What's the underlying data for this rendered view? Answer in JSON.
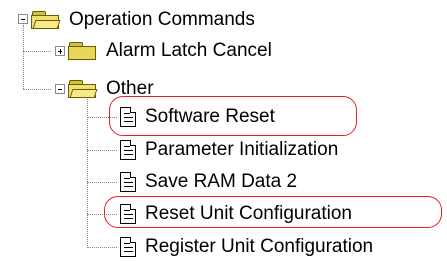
{
  "tree": {
    "root": {
      "label": "Operation Commands",
      "expanded": true,
      "icon": "open-folder-icon"
    },
    "folders": [
      {
        "label": "Alarm Latch Cancel",
        "expanded": false,
        "icon": "folder-icon"
      },
      {
        "label": "Other",
        "expanded": true,
        "icon": "open-folder-icon"
      }
    ],
    "commands": [
      {
        "label": "Software Reset",
        "icon": "document-icon",
        "highlighted": true
      },
      {
        "label": "Parameter Initialization",
        "icon": "document-icon",
        "highlighted": false
      },
      {
        "label": "Save RAM Data 2",
        "icon": "document-icon",
        "highlighted": false
      },
      {
        "label": "Reset Unit Configuration",
        "icon": "document-icon",
        "highlighted": true
      },
      {
        "label": "Register Unit Configuration",
        "icon": "document-icon",
        "highlighted": false
      }
    ]
  },
  "colors": {
    "highlight": "#e0202a",
    "folder": "#e8d65a",
    "connector": "#8a8a8a"
  }
}
